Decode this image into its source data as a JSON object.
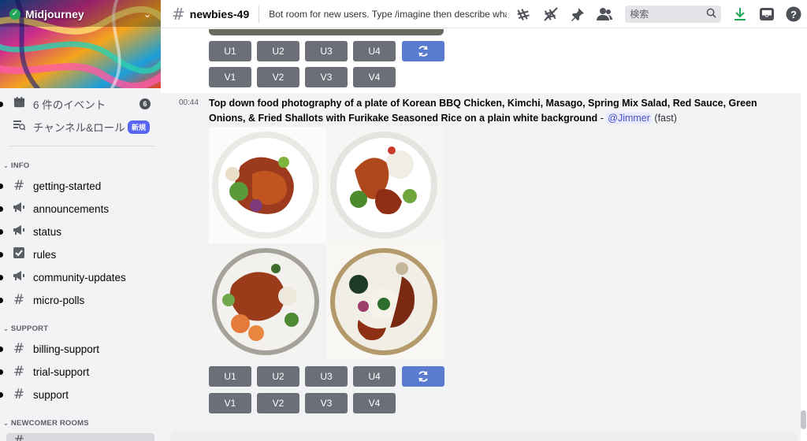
{
  "server": {
    "name": "Midjourney"
  },
  "sidebar": {
    "top_items": [
      {
        "label": "6 件のイベント",
        "count": "6",
        "icon": "calendar-icon"
      },
      {
        "label": "チャンネル&ロール",
        "badge": "新規",
        "icon": "browse-channels-icon"
      }
    ],
    "categories": [
      {
        "name": "INFO",
        "channels": [
          {
            "label": "getting-started",
            "icon": "hash-icon"
          },
          {
            "label": "announcements",
            "icon": "megaphone-icon"
          },
          {
            "label": "status",
            "icon": "megaphone-icon"
          },
          {
            "label": "rules",
            "icon": "rules-icon"
          },
          {
            "label": "community-updates",
            "icon": "megaphone-icon"
          },
          {
            "label": "micro-polls",
            "icon": "hash-icon"
          }
        ]
      },
      {
        "name": "SUPPORT",
        "channels": [
          {
            "label": "billing-support",
            "icon": "hash-icon"
          },
          {
            "label": "trial-support",
            "icon": "hash-icon"
          },
          {
            "label": "support",
            "icon": "hash-icon"
          }
        ]
      },
      {
        "name": "NEWCOMER ROOMS",
        "channels": []
      }
    ]
  },
  "header": {
    "channel": "newbies-49",
    "topic": "Bot room for new users. Type /imagine then describe wha...",
    "search_placeholder": "検索",
    "icons": [
      "threads-icon",
      "mute-icon",
      "pin-icon",
      "members-icon",
      "search-icon",
      "download-icon",
      "inbox-icon",
      "help-icon"
    ]
  },
  "messages": {
    "prev_buttons": {
      "upscale": [
        "U1",
        "U2",
        "U3",
        "U4"
      ],
      "variation": [
        "V1",
        "V2",
        "V3",
        "V4"
      ]
    },
    "message": {
      "time": "00:44",
      "prompt": "Top down food photography of a plate of Korean BBQ Chicken, Kimchi, Masago, Spring Mix Salad, Red Sauce, Green Onions, & Fried Shallots with Furikake Seasoned Rice on a plain white background",
      "separator": " - ",
      "mention": "@Jimmer",
      "mode": "(fast)",
      "buttons": {
        "upscale": [
          "U1",
          "U2",
          "U3",
          "U4"
        ],
        "variation": [
          "V1",
          "V2",
          "V3",
          "V4"
        ]
      }
    }
  },
  "colors": {
    "accent": "#5865f2",
    "button": "#6d6f78",
    "reroll": "#5b7bd1",
    "online": "#23a55a"
  }
}
